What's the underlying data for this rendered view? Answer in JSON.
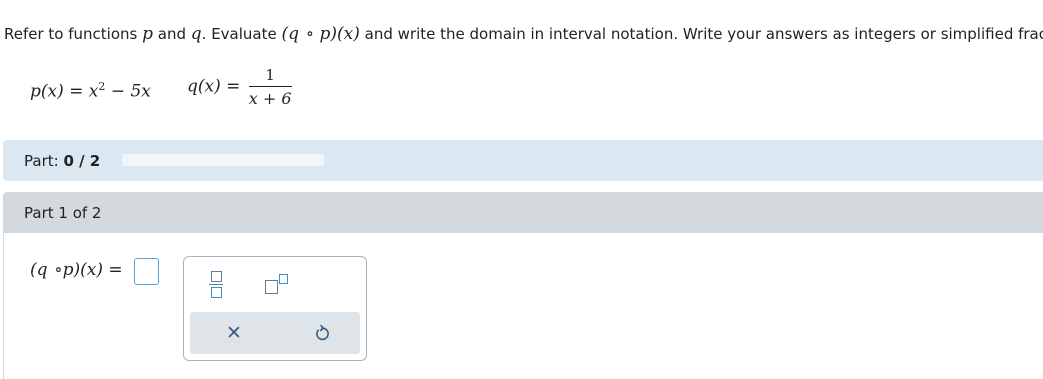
{
  "question": {
    "pre": "Refer to functions ",
    "p": "p",
    "and": " and ",
    "q": "q",
    "mid": ". Evaluate ",
    "comp": "(q  ∘ p)(x)",
    "post": " and write the domain in interval notation. Write your answers as integers or simplified fractions."
  },
  "functions": {
    "p_name": "p",
    "p_lhs_rest": "(x) = ",
    "p_x": "x",
    "p_exp": "2",
    "p_tail": " − 5x",
    "q_name": "q",
    "q_lhs_rest": "(x) = ",
    "q_num": "1",
    "q_den": "x + 6"
  },
  "progress": {
    "label": "Part: ",
    "value": "0 / 2",
    "fraction": 0.0
  },
  "part": {
    "label": "Part 1 of 2"
  },
  "answer": {
    "prefix": "(q  ∘p)(x) ="
  },
  "palette": {
    "clear_icon": "✕",
    "tools": [
      "fraction-icon",
      "exponent-icon",
      "clear-icon",
      "undo-icon"
    ]
  },
  "colors": {
    "progress_bg": "#dbe7f1",
    "part_header_bg": "#d4d9de",
    "input_border": "#5ba3d6",
    "icon_blue": "#3a5f85"
  }
}
